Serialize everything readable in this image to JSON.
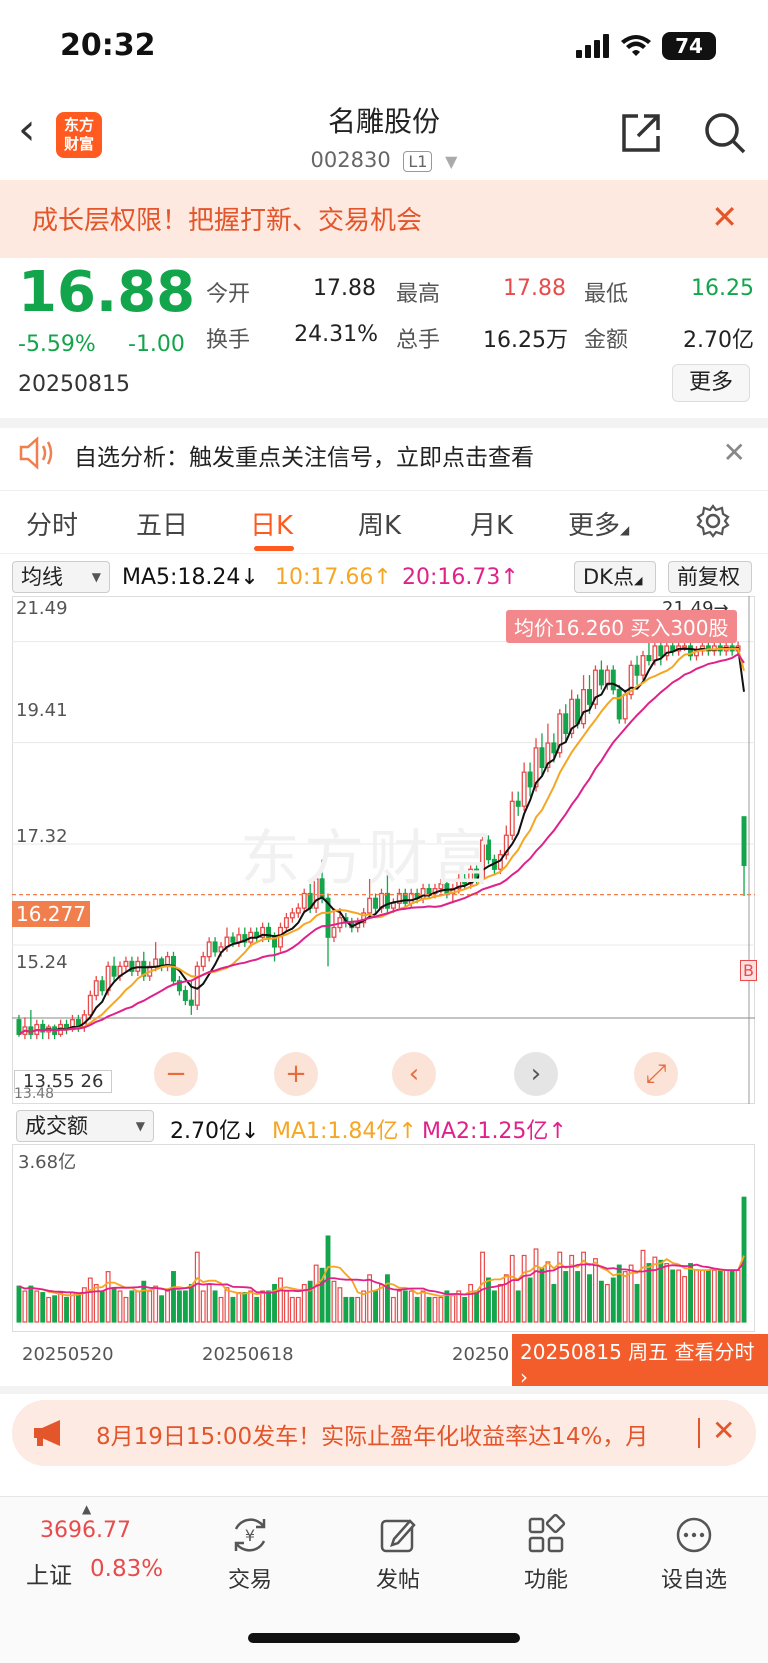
{
  "status": {
    "time": "20:32",
    "battery": "74"
  },
  "header": {
    "title": "名雕股份",
    "code": "002830",
    "level": "L1",
    "logo_line1": "东方",
    "logo_line2": "财富"
  },
  "banner": {
    "text": "成长层权限！把握打新、交易机会",
    "close": "✕"
  },
  "quote": {
    "price": "16.88",
    "change_pct": "-5.59%",
    "change": "-1.00",
    "date": "20250815",
    "open_label": "今开",
    "open": "17.88",
    "high_label": "最高",
    "high": "17.88",
    "low_label": "最低",
    "low": "16.25",
    "turnover_label": "换手",
    "turnover": "24.31%",
    "volume_label": "总手",
    "volume": "16.25万",
    "amount_label": "金额",
    "amount": "2.70亿",
    "more": "更多"
  },
  "notice": {
    "text": "自选分析：触发重点关注信号，立即点击查看",
    "close": "✕"
  },
  "tabs": [
    "分时",
    "五日",
    "日K",
    "周K",
    "月K",
    "更多"
  ],
  "ma": {
    "select": "均线",
    "ma5": "MA5:18.24",
    "ma10": "10:17.66",
    "ma20": "20:16.73",
    "dk": "DK点",
    "fq": "前复权",
    "color_ma5": "#111111",
    "color_ma10": "#f5a623",
    "color_ma20": "#e0218a"
  },
  "chart": {
    "y_labels": [
      "21.49",
      "19.41",
      "17.32",
      "15.24"
    ],
    "max_label": "21.49",
    "current_price_tag": "16.277",
    "buy_tooltip": "均价16.260 买入300股",
    "low_value": "13.55",
    "low_fragment": "26",
    "low_partial": "13.48",
    "b_marker": "B",
    "watermark": "东方财富",
    "up_color": "#e84b4b",
    "down_color": "#13a54b"
  },
  "chart_data": {
    "type": "candlestick",
    "ylim": [
      13.2,
      22.1
    ],
    "candles": [
      [
        13.7,
        13.4,
        13.8,
        13.35
      ],
      [
        13.4,
        13.55,
        13.75,
        13.3
      ],
      [
        13.55,
        13.4,
        13.9,
        13.3
      ],
      [
        13.4,
        13.6,
        13.7,
        13.3
      ],
      [
        13.6,
        13.45,
        13.7,
        13.3
      ],
      [
        13.45,
        13.55,
        13.6,
        13.3
      ],
      [
        13.55,
        13.4,
        13.6,
        13.3
      ],
      [
        13.4,
        13.6,
        13.7,
        13.35
      ],
      [
        13.6,
        13.5,
        13.7,
        13.4
      ],
      [
        13.5,
        13.7,
        13.8,
        13.45
      ],
      [
        13.7,
        13.55,
        13.8,
        13.45
      ],
      [
        13.55,
        13.8,
        13.9,
        13.45
      ],
      [
        13.8,
        14.2,
        14.3,
        13.7
      ],
      [
        14.2,
        14.5,
        14.6,
        14.1
      ],
      [
        14.5,
        14.3,
        14.6,
        14.2
      ],
      [
        14.3,
        14.8,
        14.9,
        14.2
      ],
      [
        14.8,
        14.6,
        15.0,
        14.5
      ],
      [
        14.6,
        14.8,
        14.9,
        14.5
      ],
      [
        14.8,
        14.9,
        15.0,
        14.7
      ],
      [
        14.9,
        14.7,
        15.0,
        14.6
      ],
      [
        14.7,
        14.9,
        15.0,
        14.6
      ],
      [
        14.9,
        14.6,
        15.1,
        14.5
      ],
      [
        14.6,
        14.8,
        14.9,
        14.5
      ],
      [
        14.8,
        14.95,
        15.3,
        14.7
      ],
      [
        14.95,
        14.8,
        15.0,
        14.7
      ],
      [
        14.8,
        15.0,
        15.1,
        14.7
      ],
      [
        15.0,
        14.5,
        15.1,
        14.4
      ],
      [
        14.5,
        14.3,
        14.6,
        14.2
      ],
      [
        14.3,
        14.1,
        14.4,
        14.0
      ],
      [
        14.1,
        14.0,
        14.5,
        13.8
      ],
      [
        14.0,
        14.8,
        14.9,
        13.9
      ],
      [
        14.8,
        15.0,
        15.1,
        14.7
      ],
      [
        15.0,
        15.3,
        15.4,
        14.9
      ],
      [
        15.3,
        15.1,
        15.4,
        15.0
      ],
      [
        15.1,
        15.2,
        15.3,
        15.0
      ],
      [
        15.2,
        15.4,
        15.6,
        15.1
      ],
      [
        15.4,
        15.3,
        15.5,
        15.2
      ],
      [
        15.3,
        15.45,
        15.6,
        15.2
      ],
      [
        15.45,
        15.3,
        15.6,
        15.2
      ],
      [
        15.3,
        15.5,
        15.6,
        15.2
      ],
      [
        15.5,
        15.4,
        15.6,
        15.3
      ],
      [
        15.4,
        15.6,
        15.7,
        15.3
      ],
      [
        15.6,
        15.4,
        15.7,
        15.3
      ],
      [
        15.4,
        15.2,
        15.5,
        14.9
      ],
      [
        15.2,
        15.6,
        15.7,
        15.1
      ],
      [
        15.6,
        15.8,
        15.9,
        15.5
      ],
      [
        15.8,
        15.9,
        16.0,
        15.7
      ],
      [
        15.9,
        16.0,
        16.1,
        15.8
      ],
      [
        16.0,
        16.3,
        16.4,
        15.9
      ],
      [
        16.3,
        16.0,
        16.5,
        15.9
      ],
      [
        16.0,
        16.6,
        16.7,
        15.9
      ],
      [
        16.6,
        16.2,
        17.0,
        16.1
      ],
      [
        16.2,
        15.4,
        16.3,
        14.8
      ],
      [
        15.4,
        15.6,
        16.0,
        15.3
      ],
      [
        15.6,
        15.8,
        16.0,
        15.5
      ],
      [
        15.8,
        15.7,
        15.9,
        15.6
      ],
      [
        15.7,
        15.6,
        15.8,
        15.5
      ],
      [
        15.6,
        15.7,
        15.8,
        15.5
      ],
      [
        15.7,
        15.9,
        16.0,
        15.6
      ],
      [
        15.9,
        16.2,
        16.6,
        15.8
      ],
      [
        16.2,
        16.0,
        16.3,
        15.9
      ],
      [
        16.0,
        16.3,
        16.4,
        15.9
      ],
      [
        16.3,
        16.0,
        16.7,
        15.9
      ],
      [
        16.0,
        16.1,
        16.2,
        15.9
      ],
      [
        16.1,
        16.3,
        16.4,
        16.0
      ],
      [
        16.3,
        16.1,
        16.4,
        16.0
      ],
      [
        16.1,
        16.3,
        16.4,
        16.0
      ],
      [
        16.3,
        16.2,
        16.4,
        16.1
      ],
      [
        16.2,
        16.4,
        16.5,
        16.1
      ],
      [
        16.4,
        16.3,
        16.5,
        16.2
      ],
      [
        16.3,
        16.4,
        16.5,
        16.2
      ],
      [
        16.4,
        16.5,
        16.6,
        16.3
      ],
      [
        16.5,
        16.3,
        16.6,
        16.2
      ],
      [
        16.3,
        16.4,
        16.5,
        16.1
      ],
      [
        16.4,
        16.6,
        16.7,
        16.3
      ],
      [
        16.6,
        16.5,
        16.7,
        16.4
      ],
      [
        16.5,
        16.8,
        16.9,
        16.4
      ],
      [
        16.8,
        16.6,
        16.9,
        16.5
      ],
      [
        16.6,
        17.4,
        17.5,
        16.5
      ],
      [
        17.4,
        17.0,
        17.5,
        16.9
      ],
      [
        17.0,
        16.8,
        17.1,
        16.7
      ],
      [
        16.8,
        17.1,
        17.2,
        16.7
      ],
      [
        17.1,
        17.5,
        17.7,
        17.0
      ],
      [
        17.5,
        18.2,
        18.4,
        17.4
      ],
      [
        18.2,
        18.1,
        18.4,
        17.9
      ],
      [
        18.1,
        18.8,
        19.0,
        18.0
      ],
      [
        18.8,
        18.5,
        19.0,
        18.3
      ],
      [
        18.5,
        19.3,
        19.5,
        18.4
      ],
      [
        19.3,
        18.9,
        19.6,
        18.7
      ],
      [
        18.9,
        19.4,
        19.8,
        18.8
      ],
      [
        19.4,
        19.2,
        19.6,
        19.0
      ],
      [
        19.2,
        20.0,
        20.1,
        19.1
      ],
      [
        20.0,
        19.6,
        20.2,
        19.4
      ],
      [
        19.6,
        20.3,
        20.5,
        19.5
      ],
      [
        20.3,
        19.8,
        20.4,
        19.7
      ],
      [
        19.8,
        20.5,
        20.8,
        19.7
      ],
      [
        20.5,
        20.2,
        20.8,
        20.0
      ],
      [
        20.2,
        20.9,
        21.0,
        20.1
      ],
      [
        20.9,
        20.6,
        21.1,
        20.5
      ],
      [
        20.6,
        20.9,
        21.0,
        20.5
      ],
      [
        20.9,
        20.5,
        21.0,
        20.4
      ],
      [
        20.5,
        19.9,
        20.6,
        19.8
      ],
      [
        19.9,
        20.4,
        20.5,
        19.8
      ],
      [
        20.4,
        21.0,
        21.1,
        20.3
      ],
      [
        21.0,
        20.8,
        21.2,
        20.6
      ],
      [
        20.8,
        21.2,
        21.3,
        20.7
      ],
      [
        21.2,
        21.1,
        21.49,
        21.0
      ],
      [
        21.1,
        21.4,
        21.49,
        21.0
      ],
      [
        21.4,
        21.2,
        21.49,
        21.0
      ],
      [
        21.2,
        21.4,
        21.49,
        21.1
      ],
      [
        21.4,
        21.3,
        21.49,
        21.2
      ],
      [
        21.3,
        21.4,
        21.49,
        21.2
      ],
      [
        21.4,
        21.4,
        21.49,
        21.3
      ],
      [
        21.4,
        21.2,
        21.49,
        21.1
      ],
      [
        21.2,
        21.3,
        21.4,
        21.1
      ],
      [
        21.3,
        21.4,
        21.49,
        21.2
      ],
      [
        21.4,
        21.3,
        21.49,
        21.2
      ],
      [
        21.3,
        21.4,
        21.49,
        21.2
      ],
      [
        21.4,
        21.3,
        21.49,
        21.2
      ],
      [
        21.3,
        21.4,
        21.49,
        21.2
      ],
      [
        21.4,
        21.3,
        21.49,
        21.2
      ],
      [
        21.3,
        21.4,
        21.49,
        21.2
      ],
      [
        17.88,
        16.88,
        17.88,
        16.25
      ]
    ],
    "volume_max": 3.68,
    "volumes": []
  },
  "controls": {
    "zoom_out": "−",
    "zoom_in": "+",
    "prev": "‹",
    "next": "›",
    "fullscreen": "⤢"
  },
  "vol": {
    "select": "成交额",
    "value": "2.70亿",
    "ma1": "MA1:1.84亿",
    "ma2": "MA2:1.25亿",
    "max_label": "3.68亿"
  },
  "dates": {
    "d1": "20250520",
    "d2": "20250618",
    "d3": "20250",
    "tooltip": "20250815 周五 查看分时"
  },
  "promo": {
    "text": "8月19日15:00发车！实际止盈年化收益率达14%，月",
    "close": "✕"
  },
  "bottom_nav": {
    "index_value": "3696.77",
    "index_name": "上证",
    "index_pct": "0.83%",
    "items": [
      "交易",
      "发帖",
      "功能",
      "设自选"
    ]
  }
}
